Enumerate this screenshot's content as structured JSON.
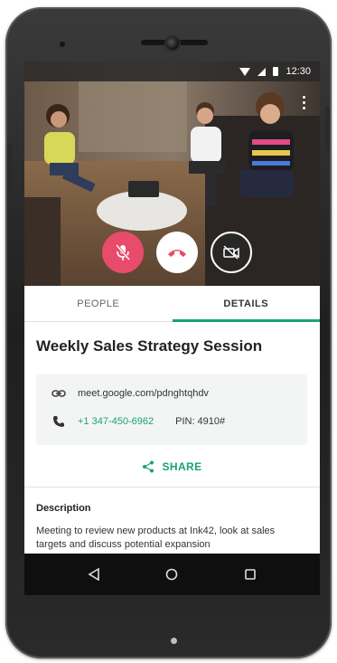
{
  "status_bar": {
    "time": "12:30"
  },
  "call_controls": {
    "mute_color": "#e94b6a",
    "end_call_icon_color": "#e94b6a"
  },
  "tabs": [
    {
      "label": "PEOPLE",
      "active": false
    },
    {
      "label": "DETAILS",
      "active": true
    }
  ],
  "accent_color": "#19a17b",
  "meeting": {
    "title": "Weekly Sales Strategy Session",
    "link": "meet.google.com/pdnghtqhdv",
    "phone": "+1 347-450-6962",
    "pin": "PIN: 4910#"
  },
  "share_label": "SHARE",
  "description": {
    "heading": "Description",
    "text": "Meeting to review new products at Ink42, look at sales targets and discuss potential expansion"
  },
  "nav": {
    "back_icon": "back-triangle-icon",
    "home_icon": "home-circle-icon",
    "recents_icon": "recents-square-icon"
  }
}
